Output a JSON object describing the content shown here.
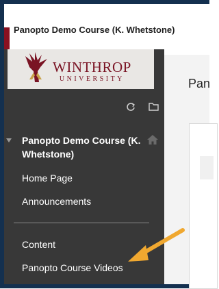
{
  "header": {
    "course_title": "Panopto Demo Course (K. Whetstone)"
  },
  "logo": {
    "word1": "WINTHROP",
    "word2": "UNIVERSITY"
  },
  "sidebar": {
    "items": [
      {
        "label": "Panopto Demo Course (K. Whetstone)"
      },
      {
        "label": "Home Page"
      },
      {
        "label": "Announcements"
      },
      {
        "label": "Content"
      },
      {
        "label": "Panopto Course Videos"
      }
    ]
  },
  "main": {
    "heading": "Pan"
  },
  "colors": {
    "sidebar_bg": "#383838",
    "frame": "#14304f",
    "brand_maroon": "#7a1424",
    "brand_gold": "#c8a24a",
    "arrow": "#f0a830"
  },
  "icons": [
    "refresh-icon",
    "folder-icon",
    "home-icon",
    "collapse-caret-icon",
    "pointer-arrow"
  ]
}
